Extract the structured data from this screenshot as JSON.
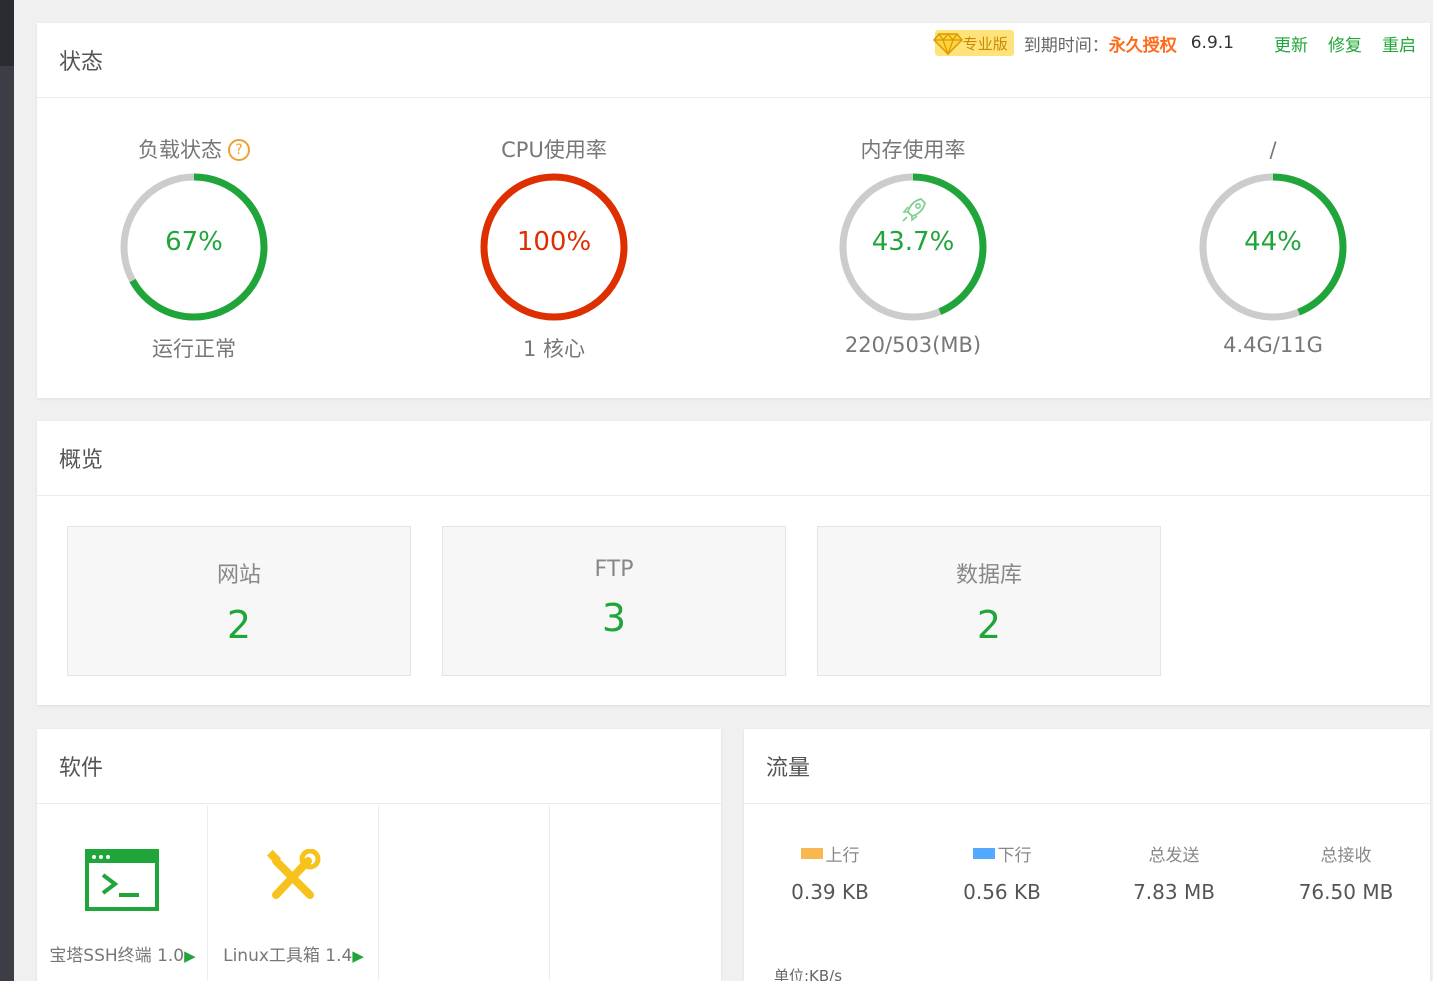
{
  "status": {
    "title": "状态",
    "badge": "专业版",
    "expire_label": "到期时间：",
    "expire_value": "永久授权",
    "version": "6.9.1",
    "links": [
      "更新",
      "修复",
      "重启"
    ],
    "gauges": [
      {
        "title": "负载状态",
        "help": "?",
        "value": "67%",
        "percent": 0.67,
        "subtitle": "运行正常",
        "color": "#20a53a"
      },
      {
        "title": "CPU使用率",
        "value": "100%",
        "percent": 1.0,
        "subtitle": "1 核心",
        "color": "#dd2f00"
      },
      {
        "title": "内存使用率",
        "value": "43.7%",
        "percent": 0.437,
        "subtitle": "220/503(MB)",
        "color": "#20a53a",
        "icon": "rocket-icon"
      },
      {
        "title": "/",
        "value": "44%",
        "percent": 0.44,
        "subtitle": "4.4G/11G",
        "color": "#20a53a"
      }
    ],
    "track_color": "#cccccc"
  },
  "overview": {
    "title": "概览",
    "cards": [
      {
        "label": "网站",
        "value": "2"
      },
      {
        "label": "FTP",
        "value": "3"
      },
      {
        "label": "数据库",
        "value": "2"
      }
    ]
  },
  "software": {
    "title": "软件",
    "items": [
      {
        "name": "宝塔SSH终端 1.0",
        "icon": "terminal-icon"
      },
      {
        "name": "Linux工具箱 1.4",
        "icon": "tools-icon"
      }
    ],
    "play": "▶"
  },
  "traffic": {
    "title": "流量",
    "columns": [
      {
        "label": "上行",
        "value": "0.39 KB",
        "swatch": "#f7b851"
      },
      {
        "label": "下行",
        "value": "0.56 KB",
        "swatch": "#52a9ff"
      },
      {
        "label": "总发送",
        "value": "7.83 MB"
      },
      {
        "label": "总接收",
        "value": "76.50 MB"
      }
    ],
    "unit": "单位:KB/s"
  },
  "colors": {
    "accent": "#20a53a",
    "danger": "#dd2f00",
    "warning": "#ff6b1a"
  }
}
